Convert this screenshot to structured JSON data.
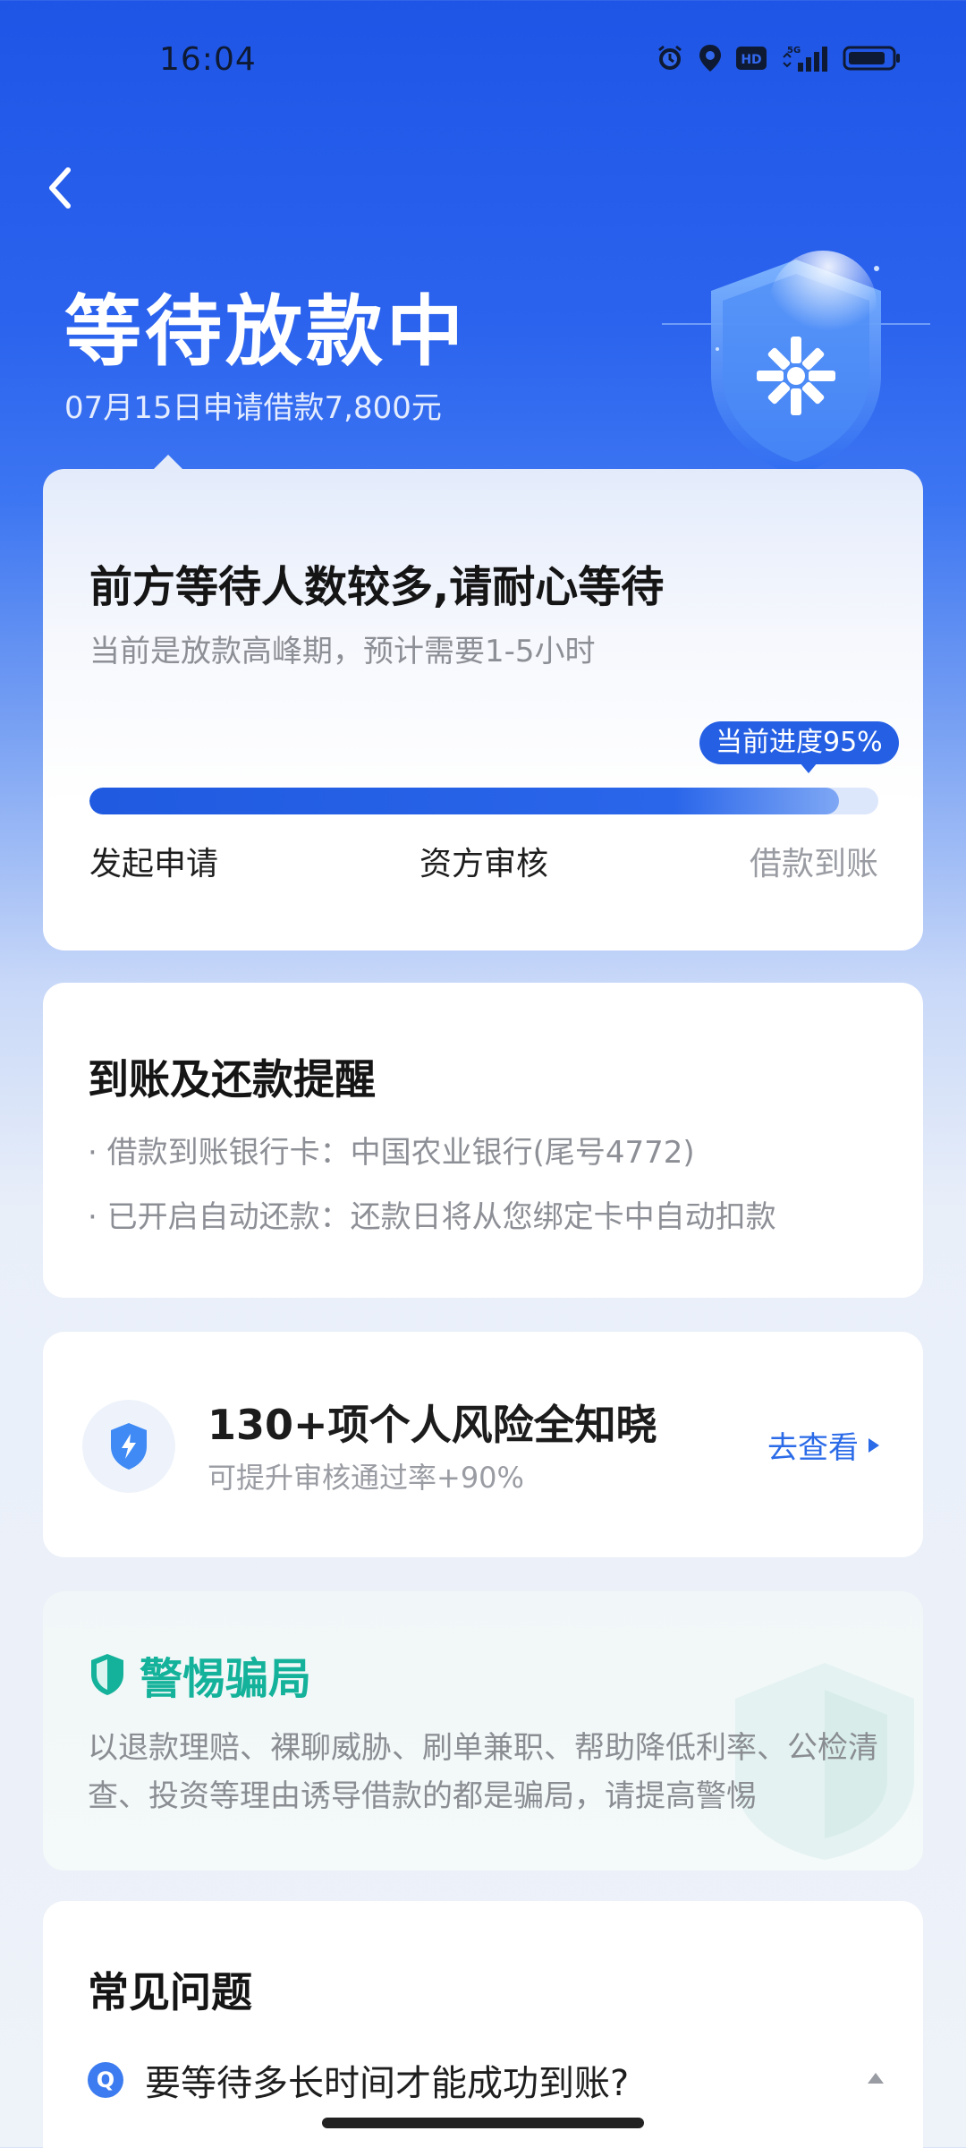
{
  "status_bar": {
    "time": "16:04",
    "icons": [
      "alarm-icon",
      "location-icon",
      "hd-icon",
      "5g-signal-icon",
      "battery-icon"
    ],
    "hd_label": "HD",
    "network_label": "5G"
  },
  "header": {
    "title": "等待放款中",
    "subtitle": "07月15日申请借款7,800元"
  },
  "progress_card": {
    "title": "前方等待人数较多,请耐心等待",
    "subtitle": "当前是放款高峰期，预计需要1-5小时",
    "progress_label": "当前进度95%",
    "progress_fraction": 0.95,
    "steps": [
      "发起申请",
      "资方审核",
      "借款到账"
    ]
  },
  "remind_card": {
    "title": "到账及还款提醒",
    "items": [
      "· 借款到账银行卡：中国农业银行(尾号4772)",
      "· 已开启自动还款：还款日将从您绑定卡中自动扣款"
    ]
  },
  "risk_card": {
    "title": "130+项个人风险全知晓",
    "subtitle": "可提升审核通过率+90%",
    "link_label": "去查看"
  },
  "fraud_card": {
    "title": "警惕骗局",
    "text": "以退款理赔、裸聊威胁、刷单兼职、帮助降低利率、公检清查、投资等理由诱导借款的都是骗局，请提高警惕"
  },
  "faq_card": {
    "title": "常见问题",
    "q_badge": "Q",
    "question": "要等待多长时间才能成功到账?"
  },
  "colors": {
    "primary_blue": "#2560e4",
    "fraud_green": "#14b29a",
    "link_blue": "#2b6be8"
  }
}
